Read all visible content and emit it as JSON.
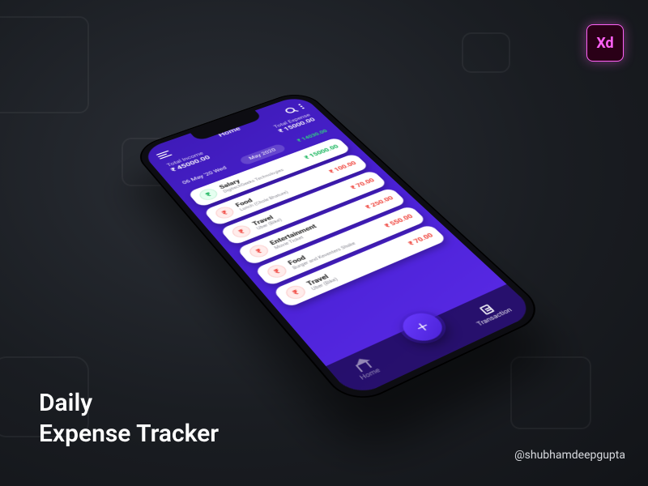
{
  "badge": {
    "label": "Xd"
  },
  "caption": {
    "line1": "Daily",
    "line2": "Expense Tracker"
  },
  "credit": "@shubhamdeepgupta",
  "app": {
    "title": "Home",
    "income": {
      "label": "Total Income",
      "value": "₹ 45000.00"
    },
    "expense": {
      "label": "Total Expense",
      "value": "₹ 15000.00"
    },
    "date": "06 May '20  Wed",
    "month": "May 2020",
    "net": "₹ 14030.00",
    "transactions": [
      {
        "category": "Salary",
        "sub": "DigitechGeeks Technologies",
        "amount": "₹ 15000.00",
        "dir": "green"
      },
      {
        "category": "Food",
        "sub": "Lunch (Chole Bhature)",
        "amount": "₹ 100.00",
        "dir": "red"
      },
      {
        "category": "Travel",
        "sub": "Uber (Bike)",
        "amount": "₹ 70.00",
        "dir": "red"
      },
      {
        "category": "Entertainment",
        "sub": "Movie Ticket",
        "amount": "₹ 250.00",
        "dir": "red"
      },
      {
        "category": "Food",
        "sub": "Burger and Keventers Shake",
        "amount": "₹ 550.00",
        "dir": "red"
      },
      {
        "category": "Travel",
        "sub": "Uber (Bike)",
        "amount": "₹ 70.00",
        "dir": "red"
      }
    ],
    "nav": {
      "home": "Home",
      "transaction": "Transaction",
      "fab": "+"
    }
  }
}
